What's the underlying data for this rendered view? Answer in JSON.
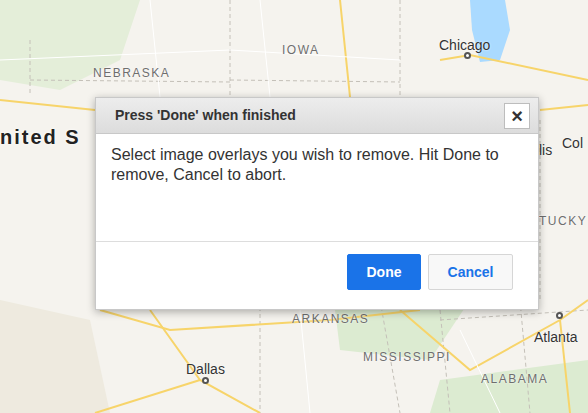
{
  "map": {
    "labels": [
      {
        "text": "IOWA",
        "kind": "state"
      },
      {
        "text": "NEBRASKA",
        "kind": "state"
      },
      {
        "text": "Chicago",
        "kind": "city"
      },
      {
        "text": "nited S",
        "kind": "country"
      },
      {
        "text": "lis",
        "kind": "city"
      },
      {
        "text": "Col",
        "kind": "city"
      },
      {
        "text": "TUCKY",
        "kind": "state"
      },
      {
        "text": "ARKANSAS",
        "kind": "state"
      },
      {
        "text": "MISSISSIPPI",
        "kind": "state"
      },
      {
        "text": "ALABAMA",
        "kind": "state"
      },
      {
        "text": "Dallas",
        "kind": "city"
      },
      {
        "text": "Atlanta",
        "kind": "city"
      }
    ]
  },
  "dialog": {
    "title": "Press 'Done' when finished",
    "close": "×",
    "message": "Select image overlays you wish to remove. Hit Done to remove, Cancel to abort.",
    "buttons": [
      {
        "label": "Done",
        "kind": "primary"
      },
      {
        "label": "Cancel",
        "kind": "secondary"
      }
    ]
  }
}
